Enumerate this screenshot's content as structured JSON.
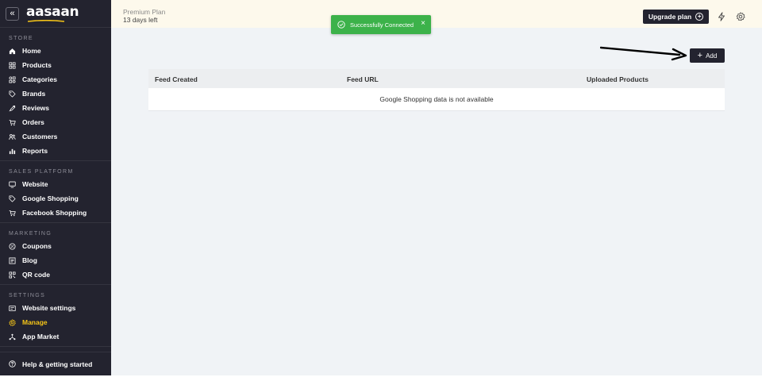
{
  "sidebar": {
    "logo": "aasaan",
    "sections": [
      {
        "title": "STORE",
        "items": [
          {
            "label": "Home",
            "icon": "home-icon"
          },
          {
            "label": "Products",
            "icon": "products-icon"
          },
          {
            "label": "Categories",
            "icon": "categories-icon"
          },
          {
            "label": "Brands",
            "icon": "tag-icon"
          },
          {
            "label": "Reviews",
            "icon": "reviews-icon"
          },
          {
            "label": "Orders",
            "icon": "cart-icon"
          },
          {
            "label": "Customers",
            "icon": "customers-icon"
          },
          {
            "label": "Reports",
            "icon": "reports-icon"
          }
        ]
      },
      {
        "title": "SALES PLATFORM",
        "items": [
          {
            "label": "Website",
            "icon": "monitor-icon"
          },
          {
            "label": "Google Shopping",
            "icon": "tag-icon"
          },
          {
            "label": "Facebook Shopping",
            "icon": "cart-icon"
          }
        ]
      },
      {
        "title": "MARKETING",
        "items": [
          {
            "label": "Coupons",
            "icon": "coupon-icon"
          },
          {
            "label": "Blog",
            "icon": "blog-icon"
          },
          {
            "label": "QR code",
            "icon": "qr-icon"
          }
        ]
      },
      {
        "title": "SETTINGS",
        "items": [
          {
            "label": "Website settings",
            "icon": "settings-panel-icon"
          },
          {
            "label": "Manage",
            "icon": "gear-icon",
            "active": true
          },
          {
            "label": "App Market",
            "icon": "apps-icon"
          }
        ]
      }
    ],
    "footer": "Help & getting started"
  },
  "topbar": {
    "plan_name": "Premium Plan",
    "plan_days": "13 days left",
    "upgrade_label": "Upgrade plan"
  },
  "toast": {
    "message": "Successfully Connected",
    "color": "#3cb24a"
  },
  "add_label": "Add",
  "table": {
    "headers": [
      "Feed Created",
      "Feed URL",
      "Uploaded Products"
    ],
    "empty_message": "Google Shopping data is not available"
  },
  "colors": {
    "sidebar_bg": "#23232f",
    "active": "#f5c518",
    "main_bg": "#f0f3f6",
    "topbar_bg": "#fdf9ec"
  }
}
